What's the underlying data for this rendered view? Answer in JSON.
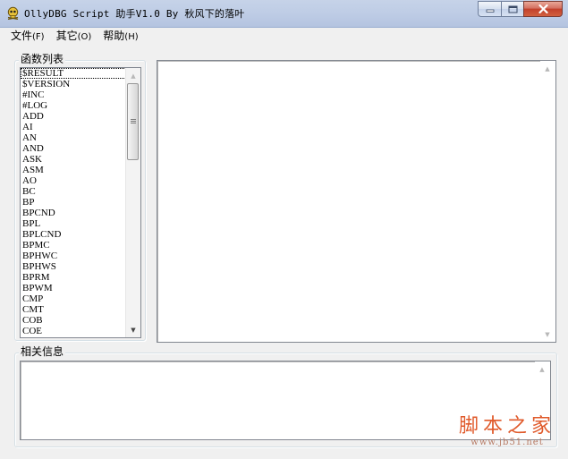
{
  "window": {
    "title": "OllyDBG Script 助手V1.0 By 秋风下的落叶",
    "icon": "skull-app-icon"
  },
  "menu": [
    {
      "label": "文件",
      "key": "(F)"
    },
    {
      "label": "其它",
      "key": "(O)"
    },
    {
      "label": "帮助",
      "key": "(H)"
    }
  ],
  "functions_group": {
    "label": "函数列表",
    "items": [
      "$RESULT",
      "$VERSION",
      "#INC",
      "#LOG",
      "ADD",
      "AI",
      "AN",
      "AND",
      "ASK",
      "ASM",
      "AO",
      "BC",
      "BP",
      "BPCND",
      "BPL",
      "BPLCND",
      "BPMC",
      "BPHWC",
      "BPHWS",
      "BPRM",
      "BPWM",
      "CMP",
      "CMT",
      "COB",
      "COE"
    ],
    "focused_index": 0,
    "scroll_position": 0.0
  },
  "info_group": {
    "label": "相关信息"
  },
  "watermark": {
    "text": "脚本之家",
    "url": "www.jb51.net",
    "color": "#e05a2b"
  }
}
